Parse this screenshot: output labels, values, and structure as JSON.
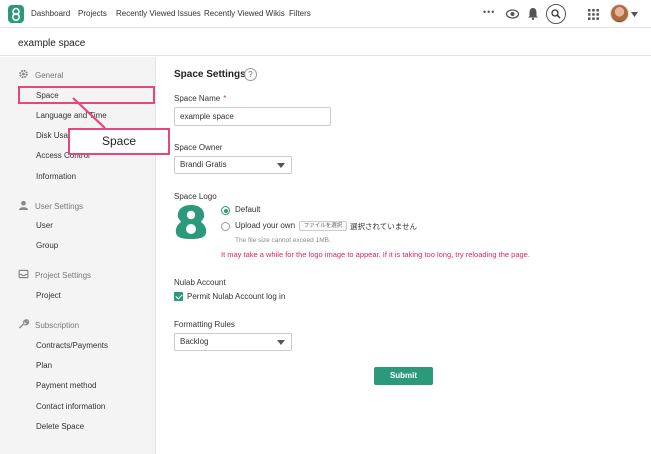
{
  "nav": {
    "items": [
      "Dashboard",
      "Projects",
      "Recently Viewed Issues",
      "Recently Viewed Wikis",
      "Filters"
    ],
    "more_label": "•••"
  },
  "space_header": {
    "title": "example space"
  },
  "sidebar": {
    "sections": [
      {
        "label": "General",
        "icon": "gear-icon"
      },
      {
        "label": "User Settings",
        "icon": "user-icon"
      },
      {
        "label": "Project Settings",
        "icon": "inbox-icon"
      },
      {
        "label": "Subscription",
        "icon": "wrench-icon"
      }
    ],
    "general_items": [
      "Space",
      "Language and Time",
      "Disk Usage",
      "Access Control",
      "Information"
    ],
    "user_items": [
      "User",
      "Group"
    ],
    "project_items": [
      "Project"
    ],
    "subscription_items": [
      "Contracts/Payments",
      "Plan",
      "Payment method",
      "Contact information",
      "Delete Space"
    ]
  },
  "annotation": {
    "callout_text": "Space",
    "color": "#e6467c"
  },
  "main": {
    "title": "Space Settings",
    "help": "?",
    "space_name_label": "Space Name",
    "required_mark": "*",
    "space_name_value": "example space",
    "space_owner_label": "Space Owner",
    "space_owner_value": "Brandi Gratis",
    "space_logo_label": "Space Logo",
    "logo_default_label": "Default",
    "logo_upload_label": "Upload your own",
    "file_button_label": "ファイルを選択",
    "file_none_text": "選択されていません",
    "file_size_hint": "The file size cannot exceed 1MB.",
    "logo_warning": "It may take a while for the logo image to appear. If it is taking too long, try reloading the page.",
    "nulab_account_label": "Nulab Account",
    "permit_label": "Permit Nulab Account log in",
    "formatting_label": "Formatting Rules",
    "formatting_value": "Backlog",
    "submit_label": "Submit"
  },
  "colors": {
    "accent": "#2c9a7a",
    "warning": "#e0245e"
  }
}
